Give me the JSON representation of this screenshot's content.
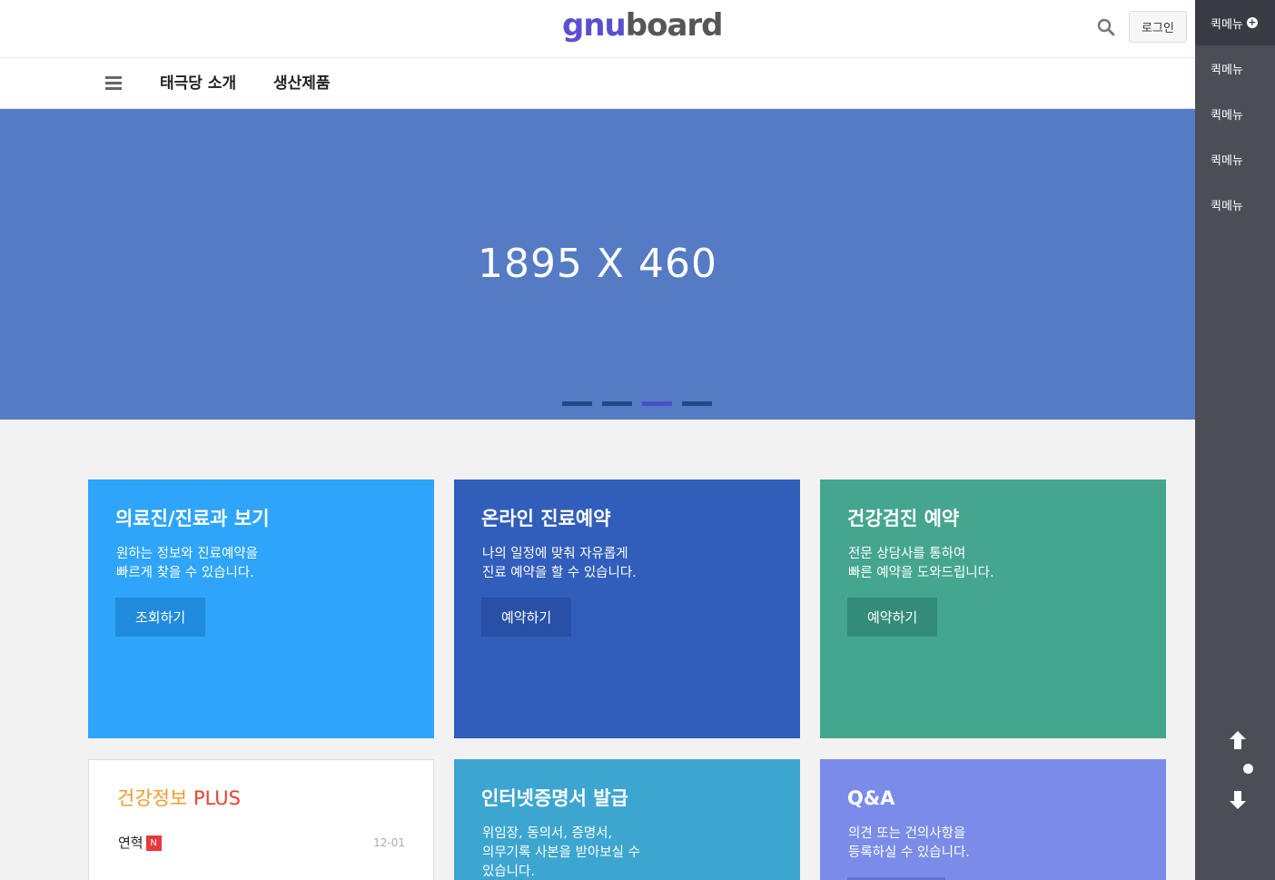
{
  "header": {
    "logo_part1": "gnu",
    "logo_part2": "board",
    "search_icon": "search-icon",
    "login_label": "로그인"
  },
  "nav": {
    "menu_icon": "hamburger-icon",
    "items": [
      {
        "label": "태극당 소개"
      },
      {
        "label": "생산제품"
      }
    ]
  },
  "hero": {
    "text": "1895 X 460",
    "slides": 4,
    "active_slide": 3
  },
  "cards": [
    {
      "title": "의료진/진료과 보기",
      "desc_line1": "원하는 정보와 진료예약을",
      "desc_line2": "빠르게 찾을 수 있습니다.",
      "button": "조회하기",
      "color": "#2ea5fb"
    },
    {
      "title": "온라인 진료예약",
      "desc_line1": "나의 일정에 맞춰 자유롭게",
      "desc_line2": "진료 예약을 할 수 있습니다.",
      "button": "예약하기",
      "color": "#315ebb"
    },
    {
      "title": "건강검진 예약",
      "desc_line1": "전문 상담사를 통하여",
      "desc_line2": "빠른 예약을 도와드립니다.",
      "button": "예약하기",
      "color": "#44a68f"
    },
    {
      "title_part1": "건강정보",
      "title_part2": "PLUS",
      "news": [
        {
          "title": "연혁",
          "badge": "N",
          "date": "12-01"
        }
      ]
    },
    {
      "title": "인터넷증명서 발급",
      "desc_line1": "위임장, 동의서, 증명서,",
      "desc_line2": "의무기록 사본을 받아보실 수",
      "desc_line3": "있습니다.",
      "color": "#3da6d0"
    },
    {
      "title": "Q&A",
      "desc_line1": "의견 또는 건의사항을",
      "desc_line2": "등록하실 수 있습니다.",
      "color": "#7a8ce8"
    }
  ],
  "quick_menu": {
    "head_label": "퀵메뉴",
    "head_icon": "plus-circle-icon",
    "items": [
      "퀵메뉴",
      "퀵메뉴",
      "퀵메뉴",
      "퀵메뉴"
    ],
    "scroll_up_icon": "arrow-up-icon",
    "scroll_down_icon": "arrow-down-icon"
  }
}
